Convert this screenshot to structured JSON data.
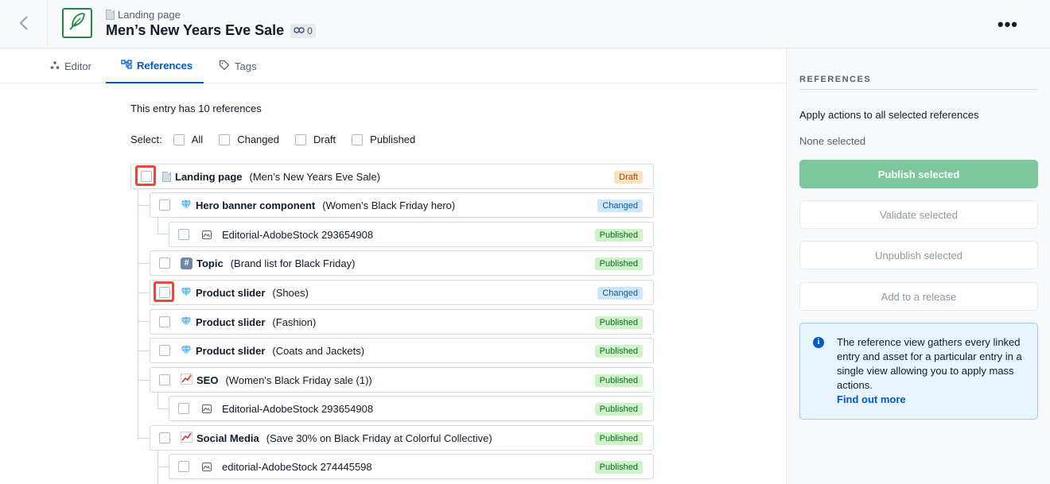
{
  "header": {
    "content_type": "Landing page",
    "title": "Men’s New Years Eve Sale",
    "reference_count": "0",
    "icons": [
      "chevron-left-icon",
      "feather-icon",
      "document-icon",
      "link-icon",
      "more-icon"
    ]
  },
  "tabs": [
    {
      "label": "Editor",
      "icon": "editor-icon"
    },
    {
      "label": "References",
      "icon": "references-icon",
      "active": true
    },
    {
      "label": "Tags",
      "icon": "tag-icon"
    }
  ],
  "main": {
    "summary": "This entry has 10 references",
    "select_label": "Select:",
    "select_options": [
      "All",
      "Changed",
      "Draft",
      "Published"
    ],
    "references": [
      {
        "type": "Landing page",
        "name": "(Men’s New Years Eve Sale)",
        "status": "Draft",
        "icon": "document-icon"
      },
      {
        "type": "Hero banner component",
        "name": "(Women's Black Friday hero)",
        "status": "Changed",
        "icon": "gem-icon"
      },
      {
        "type": "",
        "name": "Editorial-AdobeStock 293654908",
        "status": "Published",
        "icon": "image-icon"
      },
      {
        "type": "Topic",
        "name": "(Brand list for Black Friday)",
        "status": "Published",
        "icon": "hash-icon"
      },
      {
        "type": "Product slider",
        "name": "(Shoes)",
        "status": "Changed",
        "icon": "gem-icon"
      },
      {
        "type": "Product slider",
        "name": "(Fashion)",
        "status": "Published",
        "icon": "gem-icon"
      },
      {
        "type": "Product slider",
        "name": "(Coats and Jackets)",
        "status": "Published",
        "icon": "gem-icon"
      },
      {
        "type": "SEO",
        "name": "(Women's Black Friday sale (1))",
        "status": "Published",
        "icon": "chart-icon"
      },
      {
        "type": "",
        "name": "Editorial-AdobeStock 293654908",
        "status": "Published",
        "icon": "image-icon"
      },
      {
        "type": "Social Media",
        "name": "(Save 30% on Black Friday at Colorful Collective)",
        "status": "Published",
        "icon": "chart-icon"
      },
      {
        "type": "",
        "name": "editorial-AdobeStock 274445598",
        "status": "Published",
        "icon": "image-icon"
      }
    ]
  },
  "sidebar": {
    "heading": "REFERENCES",
    "apply_text": "Apply actions to all selected references",
    "selection_text": "None selected",
    "publish_label": "Publish selected",
    "validate_label": "Validate selected",
    "unpublish_label": "Unpublish selected",
    "release_label": "Add to a release",
    "note_text": "The reference view gathers every linked entry and asset for a particular entry in a single view allowing you to apply mass actions.",
    "note_link": "Find out more"
  },
  "colors": {
    "accent": "#0059c8",
    "publish_button": "#7ec79c",
    "highlight": "#e6483d",
    "draft_badge": "#fee1c3",
    "changed_badge": "#cfe6f9",
    "published_badge": "#cdf3c6"
  }
}
